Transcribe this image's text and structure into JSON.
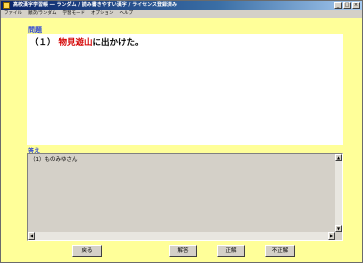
{
  "window": {
    "title": "高校漢字学習帳 ― ランダム / 読み書きやすい漢字 / ライセンス登録済み",
    "controls": [
      "_",
      "□",
      "×"
    ]
  },
  "menu": {
    "items": [
      "ファイル",
      "順次/ランダム",
      "学習モード",
      "オプション",
      "ヘルプ"
    ]
  },
  "question": {
    "label": "問題",
    "prefix": "（１）",
    "highlight": "物見遊山",
    "suffix": "に出かけた。"
  },
  "answer": {
    "label": "答え",
    "text": "（1）ものみゆさん"
  },
  "buttons": {
    "back": "戻る",
    "reveal": "解答",
    "correct": "正解",
    "incorrect": "不正解"
  }
}
